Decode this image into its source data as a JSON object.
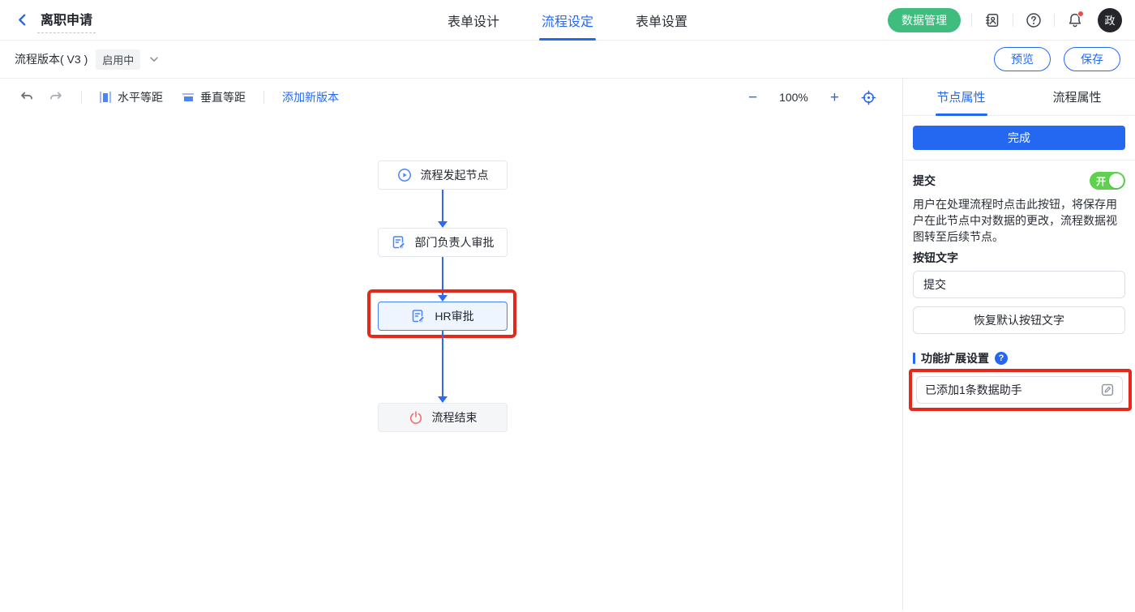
{
  "header": {
    "title": "离职申请",
    "tabs": [
      {
        "label": "表单设计",
        "active": false
      },
      {
        "label": "流程设定",
        "active": true
      },
      {
        "label": "表单设置",
        "active": false
      }
    ],
    "data_manage_label": "数据管理",
    "avatar_text": "政"
  },
  "version_bar": {
    "version_label": "流程版本( V3 )",
    "status_badge": "启用中",
    "preview_label": "预览",
    "save_label": "保存"
  },
  "toolbar": {
    "horizontal_label": "水平等距",
    "vertical_label": "垂直等距",
    "add_version_label": "添加新版本",
    "zoom_out": "−",
    "zoom_level": "100%",
    "zoom_in": "+"
  },
  "flow": {
    "nodes": [
      {
        "label": "流程发起节点",
        "icon": "play-circle-icon",
        "selected": false
      },
      {
        "label": "部门负责人审批",
        "icon": "approval-doc-icon",
        "selected": false
      },
      {
        "label": "HR审批",
        "icon": "approval-doc-icon",
        "selected": true,
        "annotated": true
      },
      {
        "label": "流程结束",
        "icon": "power-icon",
        "selected": false
      }
    ]
  },
  "panel": {
    "tabs": [
      {
        "label": "节点属性",
        "active": true
      },
      {
        "label": "流程属性",
        "active": false
      }
    ],
    "complete_button": "完成",
    "submit": {
      "label": "提交",
      "toggle_state": "开",
      "description": "用户在处理流程时点击此按钮，将保存用户在此节点中对数据的更改，流程数据视图转至后续节点。",
      "button_text_label": "按钮文字",
      "value": "提交",
      "restore_default_label": "恢复默认按钮文字"
    },
    "extension": {
      "title": "功能扩展设置",
      "assistant_text": "已添加1条数据助手"
    }
  },
  "colors": {
    "accent_blue": "#2468f2",
    "arrow_blue": "#2e6bf2",
    "green_button": "#3fbd7f",
    "toggle_green": "#5ed14e",
    "annotation_red": "#e5281c",
    "end_node_red": "#f56c6c"
  }
}
